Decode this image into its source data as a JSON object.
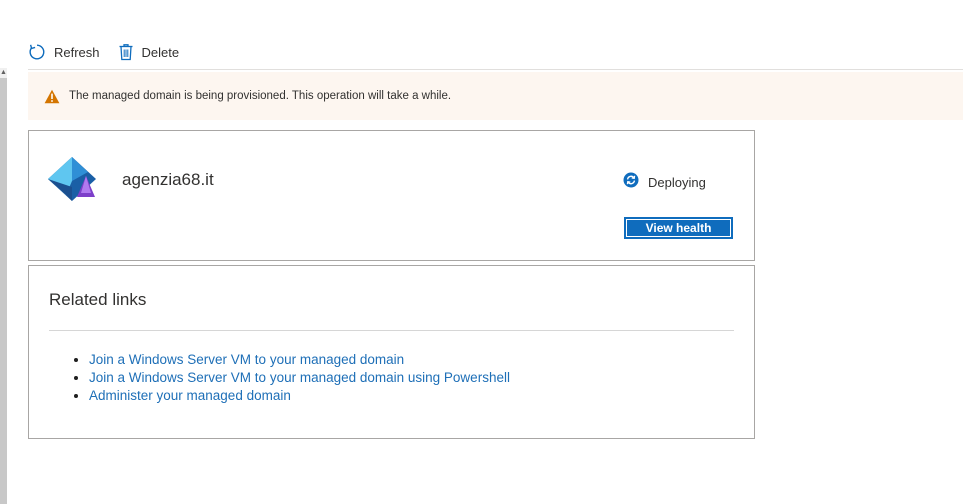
{
  "toolbar": {
    "refresh_label": "Refresh",
    "delete_label": "Delete"
  },
  "banner": {
    "message": "The managed domain is being provisioned. This operation will take a while.",
    "icon": "warning-icon",
    "color": "#d47500"
  },
  "domain_card": {
    "name": "agenzia68.it",
    "icon": "managed-domain-icon",
    "status": "Deploying",
    "status_icon": "sync-icon",
    "view_health_label": "View health"
  },
  "related_links": {
    "title": "Related links",
    "items": [
      "Join a Windows Server VM to your managed domain",
      "Join a Windows Server VM to your managed domain using Powershell",
      "Administer your managed domain"
    ]
  },
  "colors": {
    "accent": "#0f6cbd",
    "link": "#1e6fb7",
    "banner_bg": "#fdf6f0",
    "border": "#a8a6a4"
  }
}
